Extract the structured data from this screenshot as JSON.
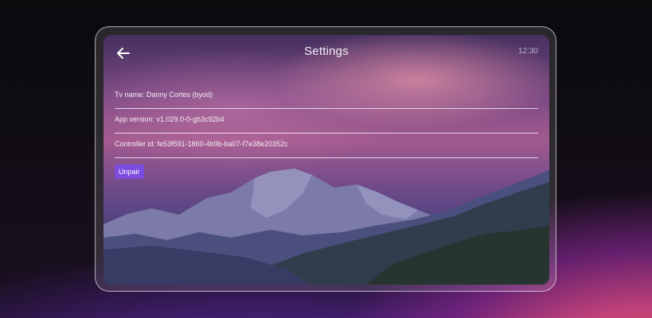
{
  "header": {
    "title": "Settings",
    "time": "12:30",
    "back_icon": "arrow-left-icon"
  },
  "info_rows": [
    {
      "text": "Tv name: Danny Cortes (byod)"
    },
    {
      "text": "App version: v1.029.0-0-gb3c92b4"
    },
    {
      "text": "Controller id: fe53f591-1860-4b9b-ba07-f7e38e20352c"
    }
  ],
  "actions": {
    "unpair_label": "Unpair"
  },
  "colors": {
    "accent": "#7c4ce0",
    "divider": "#ffffff"
  }
}
